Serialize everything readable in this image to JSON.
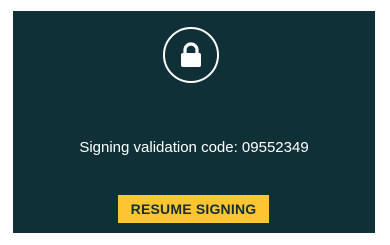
{
  "lock": {
    "icon": "lock-icon"
  },
  "validation": {
    "text": "Signing validation code: 09552349"
  },
  "resume_button": {
    "label": "RESUME SIGNING"
  },
  "colors": {
    "background": "#0f3036",
    "accent": "#fdc530",
    "text": "#ffffff"
  }
}
